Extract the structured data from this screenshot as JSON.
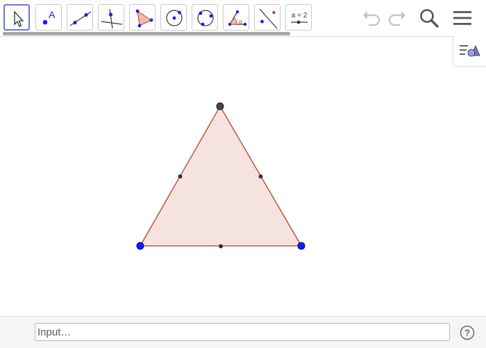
{
  "toolbar": {
    "tools": [
      {
        "name": "move-tool",
        "glyph": "cursor-arrow"
      },
      {
        "name": "point-tool",
        "glyph": "point-A",
        "label": "A"
      },
      {
        "name": "line-tool",
        "glyph": "line-through-points"
      },
      {
        "name": "perpendicular-line-tool",
        "glyph": "perpendicular"
      },
      {
        "name": "polygon-tool",
        "glyph": "triangle-polygon"
      },
      {
        "name": "circle-tool",
        "glyph": "circle-center-point"
      },
      {
        "name": "circle-three-points-tool",
        "glyph": "circle-3-points"
      },
      {
        "name": "angle-tool",
        "glyph": "angle-alpha",
        "label": "α"
      },
      {
        "name": "reflect-tool",
        "glyph": "reflect-about-line"
      },
      {
        "name": "slider-tool",
        "glyph": "slider",
        "label": "a = 2"
      }
    ],
    "undo_icon": "undo-icon",
    "redo_icon": "redo-icon",
    "search_icon": "search-icon",
    "menu_icon": "menu-icon"
  },
  "style_bar_icon": "graphics-style-icon",
  "colors": {
    "triangle_fill": "#f5e3df",
    "triangle_stroke": "#b3441c",
    "free_point": "#1a1aff",
    "dependent_point": "#333333",
    "accent": "#6a7bd1"
  },
  "input_bar": {
    "placeholder": "Input…",
    "value": "",
    "help_icon": "help-icon",
    "help_glyph": "?"
  }
}
